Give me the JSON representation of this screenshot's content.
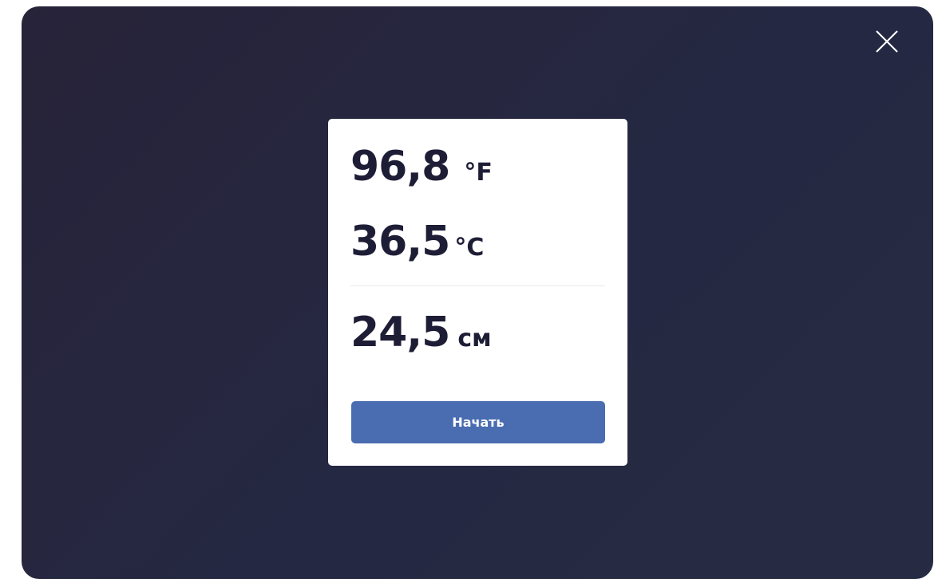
{
  "modal": {
    "close_icon": "close-icon",
    "readings": {
      "fahrenheit": {
        "value": "96,8",
        "unit": "°F"
      },
      "celsius": {
        "value": "36,5",
        "unit": "°C"
      },
      "length": {
        "value": "24,5",
        "unit": "см"
      }
    },
    "start_label": "Начать"
  },
  "colors": {
    "background": "#262842",
    "card": "#ffffff",
    "text": "#1e1d36",
    "button": "#4a6db1",
    "button_text": "#ffffff",
    "close_icon": "#ffffff"
  }
}
